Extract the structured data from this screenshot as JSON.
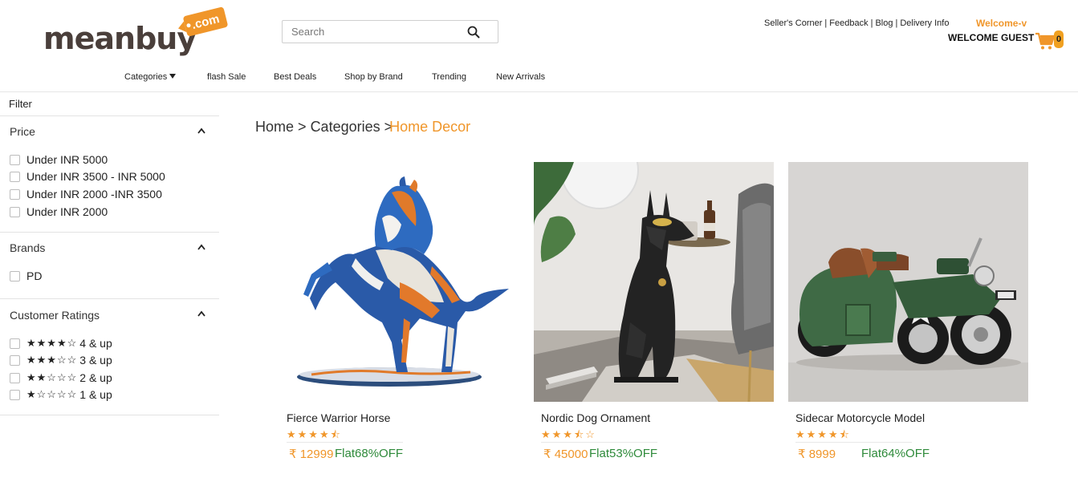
{
  "logo": {
    "text": "meanbuy",
    "tag": ".com"
  },
  "search": {
    "placeholder": "Search"
  },
  "top_links": [
    "Seller's Corner",
    "Feedback",
    "Blog",
    "Delivery Info"
  ],
  "user": {
    "welcome": "Welcome-v",
    "greeting": "WELCOME GUEST",
    "cart_count": "0"
  },
  "nav": [
    {
      "label": "Categories"
    },
    {
      "label": "flash Sale"
    },
    {
      "label": "Best Deals"
    },
    {
      "label": "Shop by Brand"
    },
    {
      "label": "Trending"
    },
    {
      "label": "New Arrivals"
    }
  ],
  "sidebar": {
    "filter_title": "Filter",
    "price": {
      "title": "Price",
      "options": [
        "Under INR 5000",
        "Under INR 3500 - INR 5000",
        "Under INR 2000 -INR 3500",
        "Under INR 2000"
      ]
    },
    "brands": {
      "title": "Brands",
      "options": [
        "PD"
      ]
    },
    "ratings": {
      "title": "Customer Ratings",
      "options": [
        {
          "stars": "★★★★☆",
          "label": "4 & up"
        },
        {
          "stars": "★★★☆☆",
          "label": "3 & up"
        },
        {
          "stars": "★★☆☆☆",
          "label": "2 & up"
        },
        {
          "stars": "★☆☆☆☆",
          "label": "1 & up"
        }
      ]
    }
  },
  "breadcrumb": {
    "home": "Home",
    "sep1": ">",
    "categories": "Categories",
    "sep2": ">",
    "current": "Home Decor"
  },
  "products": [
    {
      "name": "Fierce Warrior Horse",
      "stars": "★★★★⯪",
      "rating": 4.5,
      "price": "₹ 12999",
      "offer": "Flat68%OFF"
    },
    {
      "name": "Nordic Dog Ornament",
      "stars": "★★★⯪☆",
      "rating": 3.5,
      "price": "₹ 45000",
      "offer": "Flat53%OFF"
    },
    {
      "name": "Sidecar Motorcycle Model",
      "stars": "★★★★⯪",
      "rating": 4.5,
      "price": "₹ 8999",
      "offer": "Flat64%OFF"
    }
  ],
  "colors": {
    "accent": "#f0962a",
    "offer_green": "#2e8a3a",
    "logo_brown": "#4a3f3b"
  }
}
